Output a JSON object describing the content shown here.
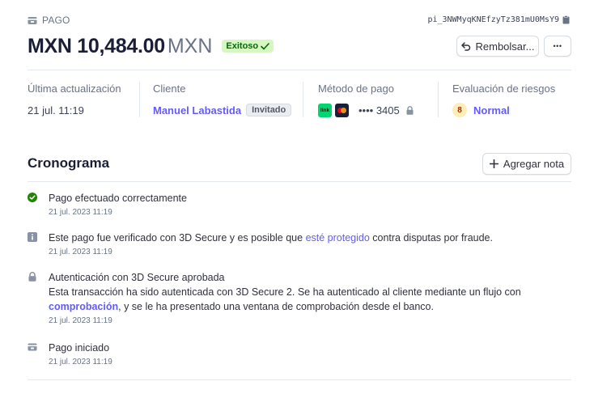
{
  "header": {
    "object_label": "PAGO",
    "payment_id": "pi_3NWMyqKNEfzyTz381mU0MsY9",
    "amount": "MXN 10,484.00",
    "currency": "MXN",
    "status_badge": "Exitoso",
    "refund_label": "Rembolsar...",
    "more_label": "•••"
  },
  "meta": {
    "last_update": {
      "title": "Última actualización",
      "value": "21 jul. 11:19"
    },
    "customer": {
      "title": "Cliente",
      "name": "Manuel Labastida",
      "tag": "Invitado"
    },
    "payment_method": {
      "title": "Método de pago",
      "link_logo": "link",
      "card_last4": "•••• 3405"
    },
    "risk": {
      "title": "Evaluación de riesgos",
      "score": "8",
      "level": "Normal"
    }
  },
  "timeline": {
    "title": "Cronograma",
    "add_note_label": "Agregar nota",
    "items": [
      {
        "icon": "check-circle-icon",
        "text": "Pago efectuado correctamente",
        "date": "21 jul. 2023 11:19"
      },
      {
        "icon": "info-icon",
        "text_before": "Este pago fue verificado con 3D Secure y es posible que ",
        "link": "esté protegido",
        "text_after": " contra disputas por fraude.",
        "date": "21 jul. 2023 11:19"
      },
      {
        "icon": "lock-icon",
        "title": "Autenticación con 3D Secure aprobada",
        "text_before": "Esta transacción ha sido autenticada con 3D Secure 2. Se ha autenticado al cliente mediante un flujo con ",
        "link": "comprobación",
        "text_after": ", y se le ha presentado una ventana de comprobación desde el banco.",
        "date": "21 jul. 2023 11:19"
      },
      {
        "icon": "payment-icon",
        "text": "Pago iniciado",
        "date": "21 jul. 2023 11:19"
      }
    ]
  },
  "colors": {
    "accent": "#635bff",
    "success_bg": "#d7f7c2",
    "success_text": "#05690d",
    "success_icon": "#228403",
    "risk_bg": "#fcedb9"
  }
}
